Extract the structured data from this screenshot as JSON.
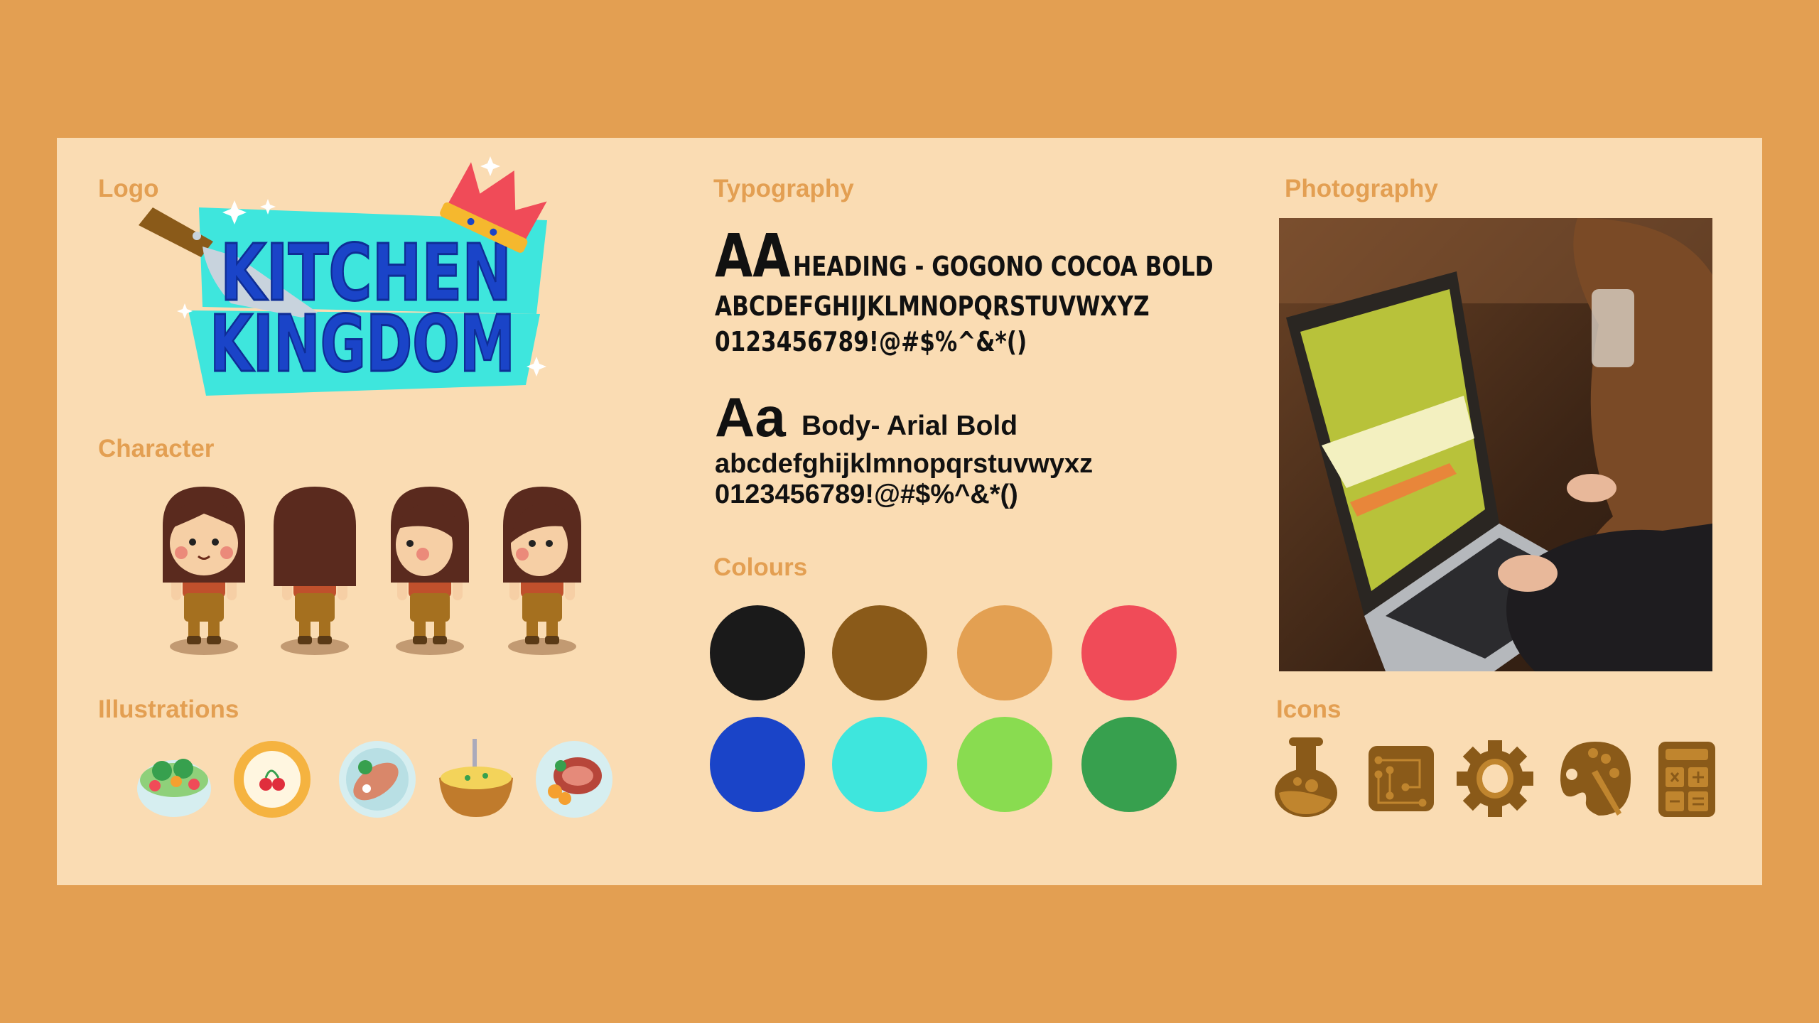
{
  "sections": {
    "logo": "Logo",
    "character": "Character",
    "illustrations": "Illustrations",
    "typography": "Typography",
    "colours": "Colours",
    "photography": "Photography",
    "icons": "Icons"
  },
  "logo": {
    "line1": "KITCHEN",
    "line2": "KINGDOM"
  },
  "typography": {
    "heading": {
      "sample": "AA",
      "name": "HEADING - GOGONO COCOA BOLD",
      "alphabet": "ABCDEFGHIJKLMNOPQRSTUVWXYZ",
      "numbers": "0123456789!@#$%^&*()"
    },
    "body": {
      "sample": "Aa",
      "name": "Body- Arial Bold",
      "alphabet": "abcdefghijklmnopqrstuvwyxz",
      "numbers": "0123456789!@#$%^&*()"
    }
  },
  "colours": [
    "#1a1a1a",
    "#8a5a19",
    "#e3a052",
    "#f04b58",
    "#1a44c8",
    "#3ee6dd",
    "#89dc50",
    "#37a04e"
  ],
  "illustrations": [
    "salad-icon",
    "cherry-tart-icon",
    "fish-dish-icon",
    "soup-bowl-icon",
    "steak-plate-icon"
  ],
  "icons": [
    "flask-icon",
    "circuit-board-icon",
    "gear-icon",
    "palette-icon",
    "calculator-icon"
  ],
  "icon_colors": {
    "dark": "#8a5a19",
    "light": "#c0852e"
  }
}
